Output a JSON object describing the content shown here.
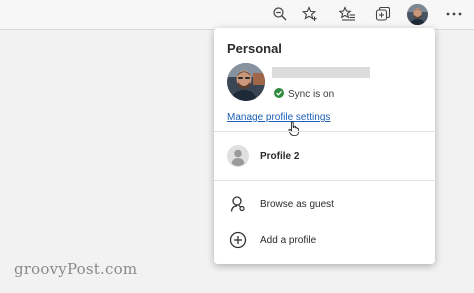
{
  "toolbar": {
    "icons": [
      "zoom-out-icon",
      "favorite-star-icon",
      "favorites-list-icon",
      "collections-icon",
      "profile-avatar-icon",
      "more-options-icon"
    ]
  },
  "profile_panel": {
    "heading": "Personal",
    "sync_status": "Sync is on",
    "manage_link": "Manage profile settings",
    "other_profile_label": "Profile 2",
    "guest_label": "Browse as guest",
    "add_profile_label": "Add a profile"
  },
  "watermark": "groovyPost.com",
  "colors": {
    "link": "#1a5fb4",
    "sync_check": "#2e8b3e",
    "panel_bg": "#ffffff",
    "page_bg": "#f2f2f2"
  }
}
